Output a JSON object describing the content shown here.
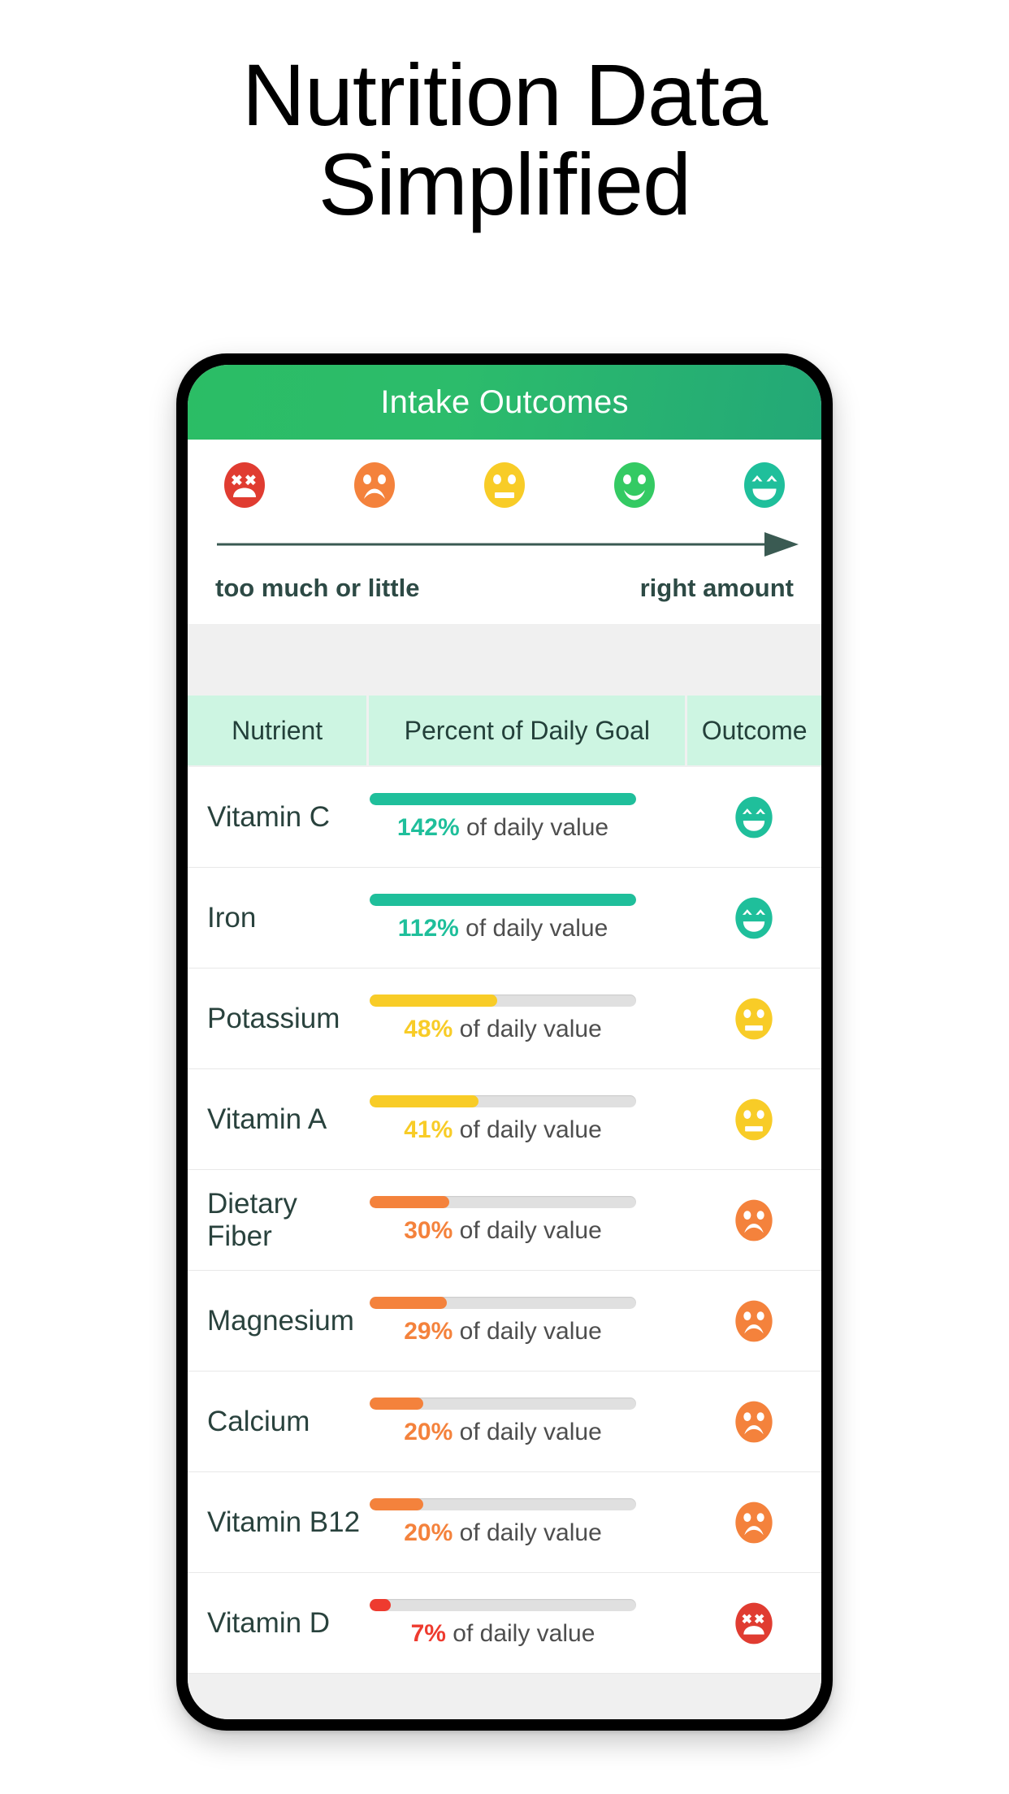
{
  "headline": {
    "line1": "Nutrition Data",
    "line2": "Simplified"
  },
  "app": {
    "title": "Intake Outcomes",
    "header_gradient_from": "#2bbd65",
    "header_gradient_to": "#23a877"
  },
  "legend": {
    "faces": [
      {
        "name": "face-dead-red",
        "mood": "too much or little",
        "color": "#e03c31"
      },
      {
        "name": "face-sad-orange",
        "mood": "low",
        "color": "#f4823c"
      },
      {
        "name": "face-neutral-yellow",
        "mood": "medium",
        "color": "#f8cc27"
      },
      {
        "name": "face-smile-green",
        "mood": "good",
        "color": "#34ca63"
      },
      {
        "name": "face-grin-teal",
        "mood": "right amount",
        "color": "#1fbf9b"
      }
    ],
    "left_label": "too much or little",
    "right_label": "right amount",
    "arrow_color": "#3a5a52"
  },
  "table": {
    "columns": [
      "Nutrient",
      "Percent of Daily Goal",
      "Outcome"
    ],
    "value_suffix": "of daily value",
    "rows": [
      {
        "nutrient": "Vitamin C",
        "percent_label": "142%",
        "percent": 142,
        "fill": 100,
        "color": "#1fbf9b",
        "face": "face-grin-teal"
      },
      {
        "nutrient": "Iron",
        "percent_label": "112%",
        "percent": 112,
        "fill": 100,
        "color": "#1fbf9b",
        "face": "face-grin-teal"
      },
      {
        "nutrient": "Potassium",
        "percent_label": "48%",
        "percent": 48,
        "fill": 48,
        "color": "#f8cc27",
        "face": "face-neutral-yellow"
      },
      {
        "nutrient": "Vitamin A",
        "percent_label": "41%",
        "percent": 41,
        "fill": 41,
        "color": "#f8cc27",
        "face": "face-neutral-yellow"
      },
      {
        "nutrient": "Dietary Fiber",
        "percent_label": "30%",
        "percent": 30,
        "fill": 30,
        "color": "#f4823c",
        "face": "face-sad-orange"
      },
      {
        "nutrient": "Magnesium",
        "percent_label": "29%",
        "percent": 29,
        "fill": 29,
        "color": "#f4823c",
        "face": "face-sad-orange"
      },
      {
        "nutrient": "Calcium",
        "percent_label": "20%",
        "percent": 20,
        "fill": 20,
        "color": "#f4823c",
        "face": "face-sad-orange"
      },
      {
        "nutrient": "Vitamin B12",
        "percent_label": "20%",
        "percent": 20,
        "fill": 20,
        "color": "#f4823c",
        "face": "face-sad-orange"
      },
      {
        "nutrient": "Vitamin D",
        "percent_label": "7%",
        "percent": 7,
        "fill": 8,
        "color": "#ee3b2f",
        "face": "face-dead-red"
      }
    ]
  },
  "chart_data": {
    "type": "bar",
    "title": "Percent of Daily Goal",
    "xlabel": "",
    "ylabel": "Nutrient",
    "categories": [
      "Vitamin C",
      "Iron",
      "Potassium",
      "Vitamin A",
      "Dietary Fiber",
      "Magnesium",
      "Calcium",
      "Vitamin B12",
      "Vitamin D"
    ],
    "values": [
      142,
      112,
      48,
      41,
      30,
      29,
      20,
      20,
      7
    ],
    "unit": "% of daily value",
    "xlim": [
      0,
      100
    ],
    "grid": false,
    "legend": "none"
  }
}
